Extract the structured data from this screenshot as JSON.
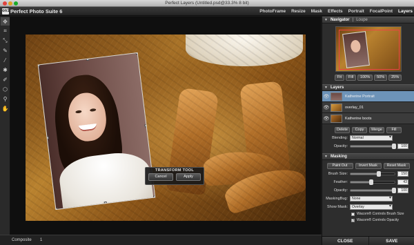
{
  "window": {
    "title": "Perfect Layers (Untitled.psd@33.3% 8 bit)"
  },
  "app": {
    "logo": "on1",
    "name": "Perfect Photo Suite 6"
  },
  "modules": [
    "PhotoFrame",
    "Resize",
    "Mask",
    "Effects",
    "Portrait",
    "FocalPoint",
    "Layers"
  ],
  "active_module": "Layers",
  "tools": [
    "move-icon",
    "crop-icon",
    "transform-icon",
    "brush-icon",
    "eyedropper-icon",
    "masking-bug-icon",
    "retouch-icon",
    "clone-icon",
    "zoom-icon",
    "hand-icon"
  ],
  "transform_dialog": {
    "title": "TRANSFORM TOOL",
    "cancel": "Cancel",
    "apply": "Apply"
  },
  "status": {
    "label": "Composite",
    "value": "1"
  },
  "navigator": {
    "tabs": [
      "Navigator",
      "Loupe"
    ],
    "zoom_buttons": [
      "Fit",
      "Fill",
      "100%",
      "50%",
      "25%"
    ]
  },
  "layers": {
    "title": "Layers",
    "items": [
      {
        "name": "Katherine Portrait",
        "selected": true
      },
      {
        "name": "overlay_01",
        "selected": false
      },
      {
        "name": "Katherine boots",
        "selected": false
      }
    ],
    "actions": [
      "Delete",
      "Copy",
      "Merge",
      "Fill"
    ],
    "blending_label": "Blending:",
    "blending_value": "Normal",
    "opacity_label": "Opacity:",
    "opacity_value": "100"
  },
  "masking": {
    "title": "Masking",
    "buttons": [
      "Paint Out",
      "Invert Mask",
      "Reset Mask"
    ],
    "brush_size_label": "Brush Size:",
    "brush_size_value": "150",
    "feather_label": "Feather:",
    "feather_value": "43",
    "opacity_label": "Opacity:",
    "opacity_value": "100",
    "masking_bug_label": "MaskingBug:",
    "masking_bug_value": "None",
    "show_mask_label": "Show Mask:",
    "show_mask_value": "Overlay",
    "checkbox_1": "Wacom® Controls Brush Size",
    "checkbox_2": "Wacom® Controls Opacity"
  },
  "footer": {
    "close": "CLOSE",
    "save": "SAVE"
  },
  "colors": {
    "selected_layer": "#6d93b8",
    "panel_bg": "#2d2d2d",
    "canvas_bg": "#0f0f0f"
  }
}
